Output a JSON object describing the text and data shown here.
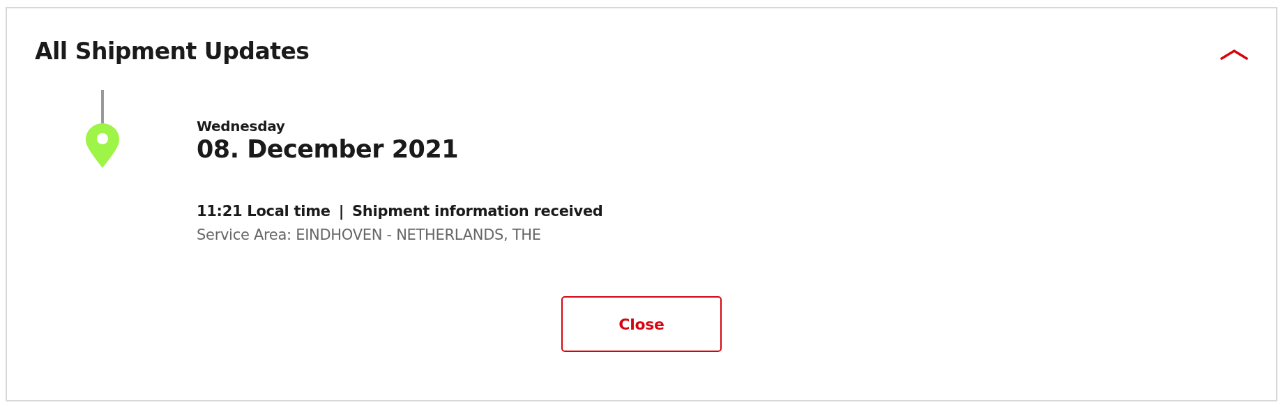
{
  "panel": {
    "title": "All Shipment Updates",
    "expanded": true
  },
  "events": [
    {
      "weekday": "Wednesday",
      "date": "08. December 2021",
      "time": "11:21 Local time",
      "separator": "|",
      "status": "Shipment information received",
      "location": "Service Area: EINDHOVEN - NETHERLANDS, THE"
    }
  ],
  "close_button": {
    "label": "Close"
  }
}
